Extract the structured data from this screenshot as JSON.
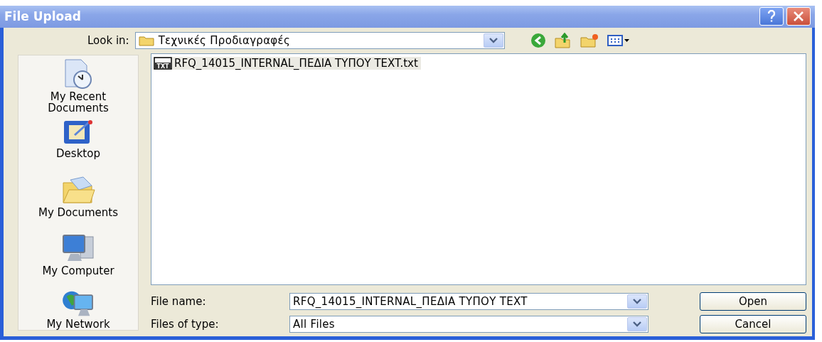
{
  "window": {
    "title": "File Upload"
  },
  "look_in": {
    "label": "Look in:",
    "value": "Τεχνικές Προδιαγραφές"
  },
  "places": [
    {
      "kind": "recent",
      "label": "My Recent Documents"
    },
    {
      "kind": "desktop",
      "label": "Desktop"
    },
    {
      "kind": "documents",
      "label": "My Documents"
    },
    {
      "kind": "computer",
      "label": "My Computer"
    },
    {
      "kind": "network",
      "label": "My Network"
    }
  ],
  "files": [
    {
      "name": "RFQ_14015_INTERNAL_ΠΕΔΙΑ ΤΥΠΟΥ TEXT.txt",
      "icon_text": "TXT",
      "selected": true
    }
  ],
  "file_name": {
    "label": "File name:",
    "value": "RFQ_14015_INTERNAL_ΠΕΔΙΑ ΤΥΠΟΥ TEXT"
  },
  "file_type": {
    "label": "Files of type:",
    "value": "All Files"
  },
  "buttons": [
    "Open",
    "Cancel"
  ]
}
